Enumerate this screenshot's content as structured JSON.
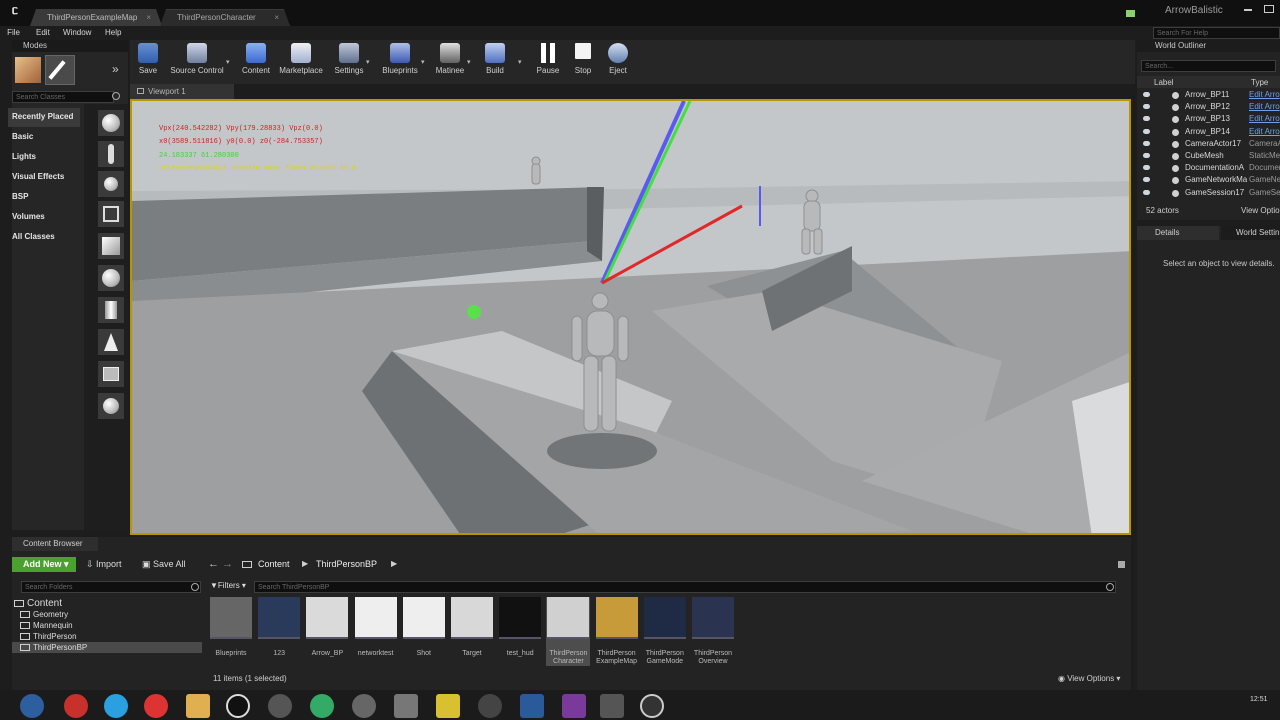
{
  "title_bar": {
    "tabs": [
      "ThirdPersonExampleMap",
      "ThirdPersonCharacter"
    ],
    "project_name": "ArrowBalistic"
  },
  "menu": [
    "File",
    "Edit",
    "Window",
    "Help"
  ],
  "modes_panel": {
    "title": "Modes",
    "search_placeholder": "Search Classes",
    "categories": [
      "Recently Placed",
      "Basic",
      "Lights",
      "Visual Effects",
      "BSP",
      "Volumes",
      "All Classes"
    ]
  },
  "toolbar": {
    "buttons": [
      "Save",
      "Source Control",
      "Content",
      "Marketplace",
      "Settings",
      "Blueprints",
      "Matinee",
      "Build",
      "Pause",
      "Stop",
      "Eject"
    ]
  },
  "viewport": {
    "tab_label": "Viewport 1",
    "stats": [
      "Vpx(240.542282)  Vpy(179.28833)  Vpz(0.0)",
      "x0(3589.511816)  y0(0.0)  z0(-284.753357)",
      "24.183337    61.280300",
      "DistanceShoot=28.709633m  None Time4.011025  69.0"
    ],
    "colors": {
      "stat_red": "#d02020",
      "stat_green": "#39d639",
      "stat_yellow": "#d8d800",
      "border": "#b89600"
    }
  },
  "world_outliner": {
    "title": "World Outliner",
    "search_help_placeholder": "Search For Help",
    "search_placeholder": "Search...",
    "col_label": "Label",
    "col_type": "Type",
    "rows": [
      {
        "label": "Arrow_BP11",
        "type": "Edit Arro"
      },
      {
        "label": "Arrow_BP12",
        "type": "Edit Arro"
      },
      {
        "label": "Arrow_BP13",
        "type": "Edit Arro"
      },
      {
        "label": "Arrow_BP14",
        "type": "Edit Arro"
      },
      {
        "label": "CameraActor17",
        "type": "CameraA"
      },
      {
        "label": "CubeMesh",
        "type": "StaticMe"
      },
      {
        "label": "DocumentationA",
        "type": "Documen"
      },
      {
        "label": "GameNetworkMa",
        "type": "GameNe"
      },
      {
        "label": "GameSession17",
        "type": "GameSe"
      }
    ],
    "actors_count": "52 actors",
    "view_options": "View Optio"
  },
  "details": {
    "tab_details": "Details",
    "tab_world": "World Settin",
    "empty_text": "Select an object to view details."
  },
  "content_browser": {
    "title": "Content Browser",
    "add_new": "Add New",
    "import": "Import",
    "save_all": "Save All",
    "breadcrumb": [
      "Content",
      "ThirdPersonBP"
    ],
    "search_folders_placeholder": "Search Folders",
    "filters": "Filters",
    "search_assets_placeholder": "Search ThirdPersonBP",
    "folders": [
      "Content",
      "Geometry",
      "Mannequin",
      "ThirdPerson",
      "ThirdPersonBP"
    ],
    "assets": [
      "Blueprints",
      "123",
      "Arrow_BP",
      "networktest",
      "Shot",
      "Target",
      "test_hud",
      "ThirdPerson Character",
      "ThirdPerson ExampleMap",
      "ThirdPerson GameMode",
      "ThirdPerson Overview"
    ],
    "status": "11 items (1 selected)",
    "view_options": "View Options",
    "accent_add_new": "#4aa12e"
  },
  "taskbar": {
    "clock": "12:51"
  }
}
